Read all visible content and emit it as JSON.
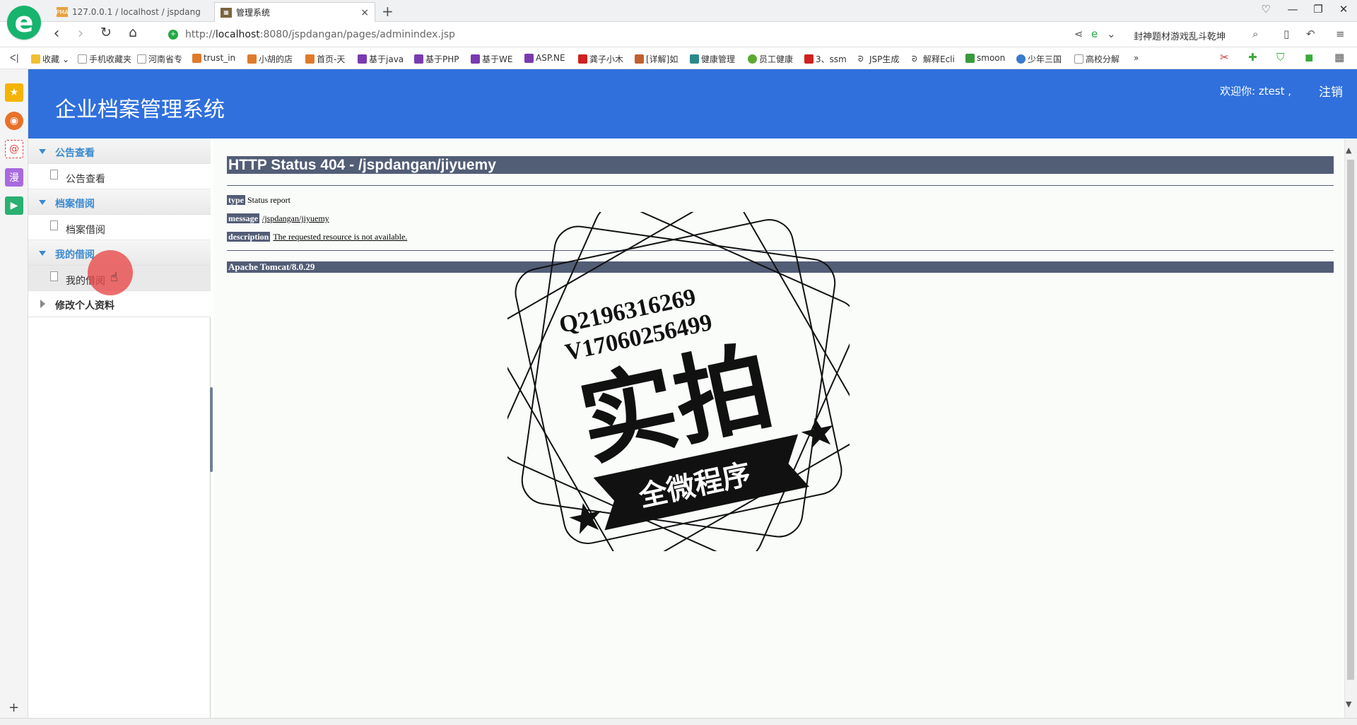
{
  "browser": {
    "logo_letter": "e",
    "tabs": [
      {
        "label": "127.0.0.1 / localhost / jspdang",
        "favicon": "phpmyadmin-icon"
      },
      {
        "label": "管理系统",
        "favicon": "app-icon",
        "close": "×"
      }
    ],
    "new_tab": "+",
    "url_prefix": "http://",
    "url_host": "localhost",
    "url_rest": ":8080/jspdangan/pages/adminindex.jsp",
    "search_text": "封神题材游戏乱斗乾坤",
    "bookmarks": [
      "收藏",
      "手机收藏夹",
      "河南省专",
      "trust_in",
      "小胡的店",
      "首页-天",
      "基于java",
      "基于PHP",
      "基于WE",
      "ASP.NE",
      "龚子小木",
      "[详解]如",
      "健康管理",
      "员工健康",
      "3、ssm",
      "JSP生成",
      "解释Ecli",
      "smoon",
      "少年三国",
      "高校分解"
    ],
    "more": "»"
  },
  "app": {
    "title": "企业档案管理系统",
    "welcome": "欢迎你: ztest ,",
    "logout": "注销",
    "menu": [
      {
        "group": "公告查看",
        "items": [
          "公告查看"
        ]
      },
      {
        "group": "档案借阅",
        "items": [
          "档案借阅"
        ]
      },
      {
        "group": "我的借阅",
        "items": [
          "我的借阅"
        ]
      },
      {
        "group": "修改个人资料",
        "items": []
      }
    ]
  },
  "error_page": {
    "title": "HTTP Status 404 - /jspdangan/jiyuemy",
    "type_label": "type",
    "type_value": "Status report",
    "message_label": "message",
    "message_value": "/jspdangan/jiyuemy",
    "description_label": "description",
    "description_value": "The requested resource is not available.",
    "server": "Apache Tomcat/8.0.29"
  },
  "watermark": {
    "line1": "Q2196316269",
    "line2": "V17060256499",
    "big": "实拍",
    "banner": "全微程序"
  },
  "colors": {
    "header_blue": "#3070dd",
    "menu_accent": "#3a8ad0",
    "tomcat_bar": "#525d76"
  }
}
